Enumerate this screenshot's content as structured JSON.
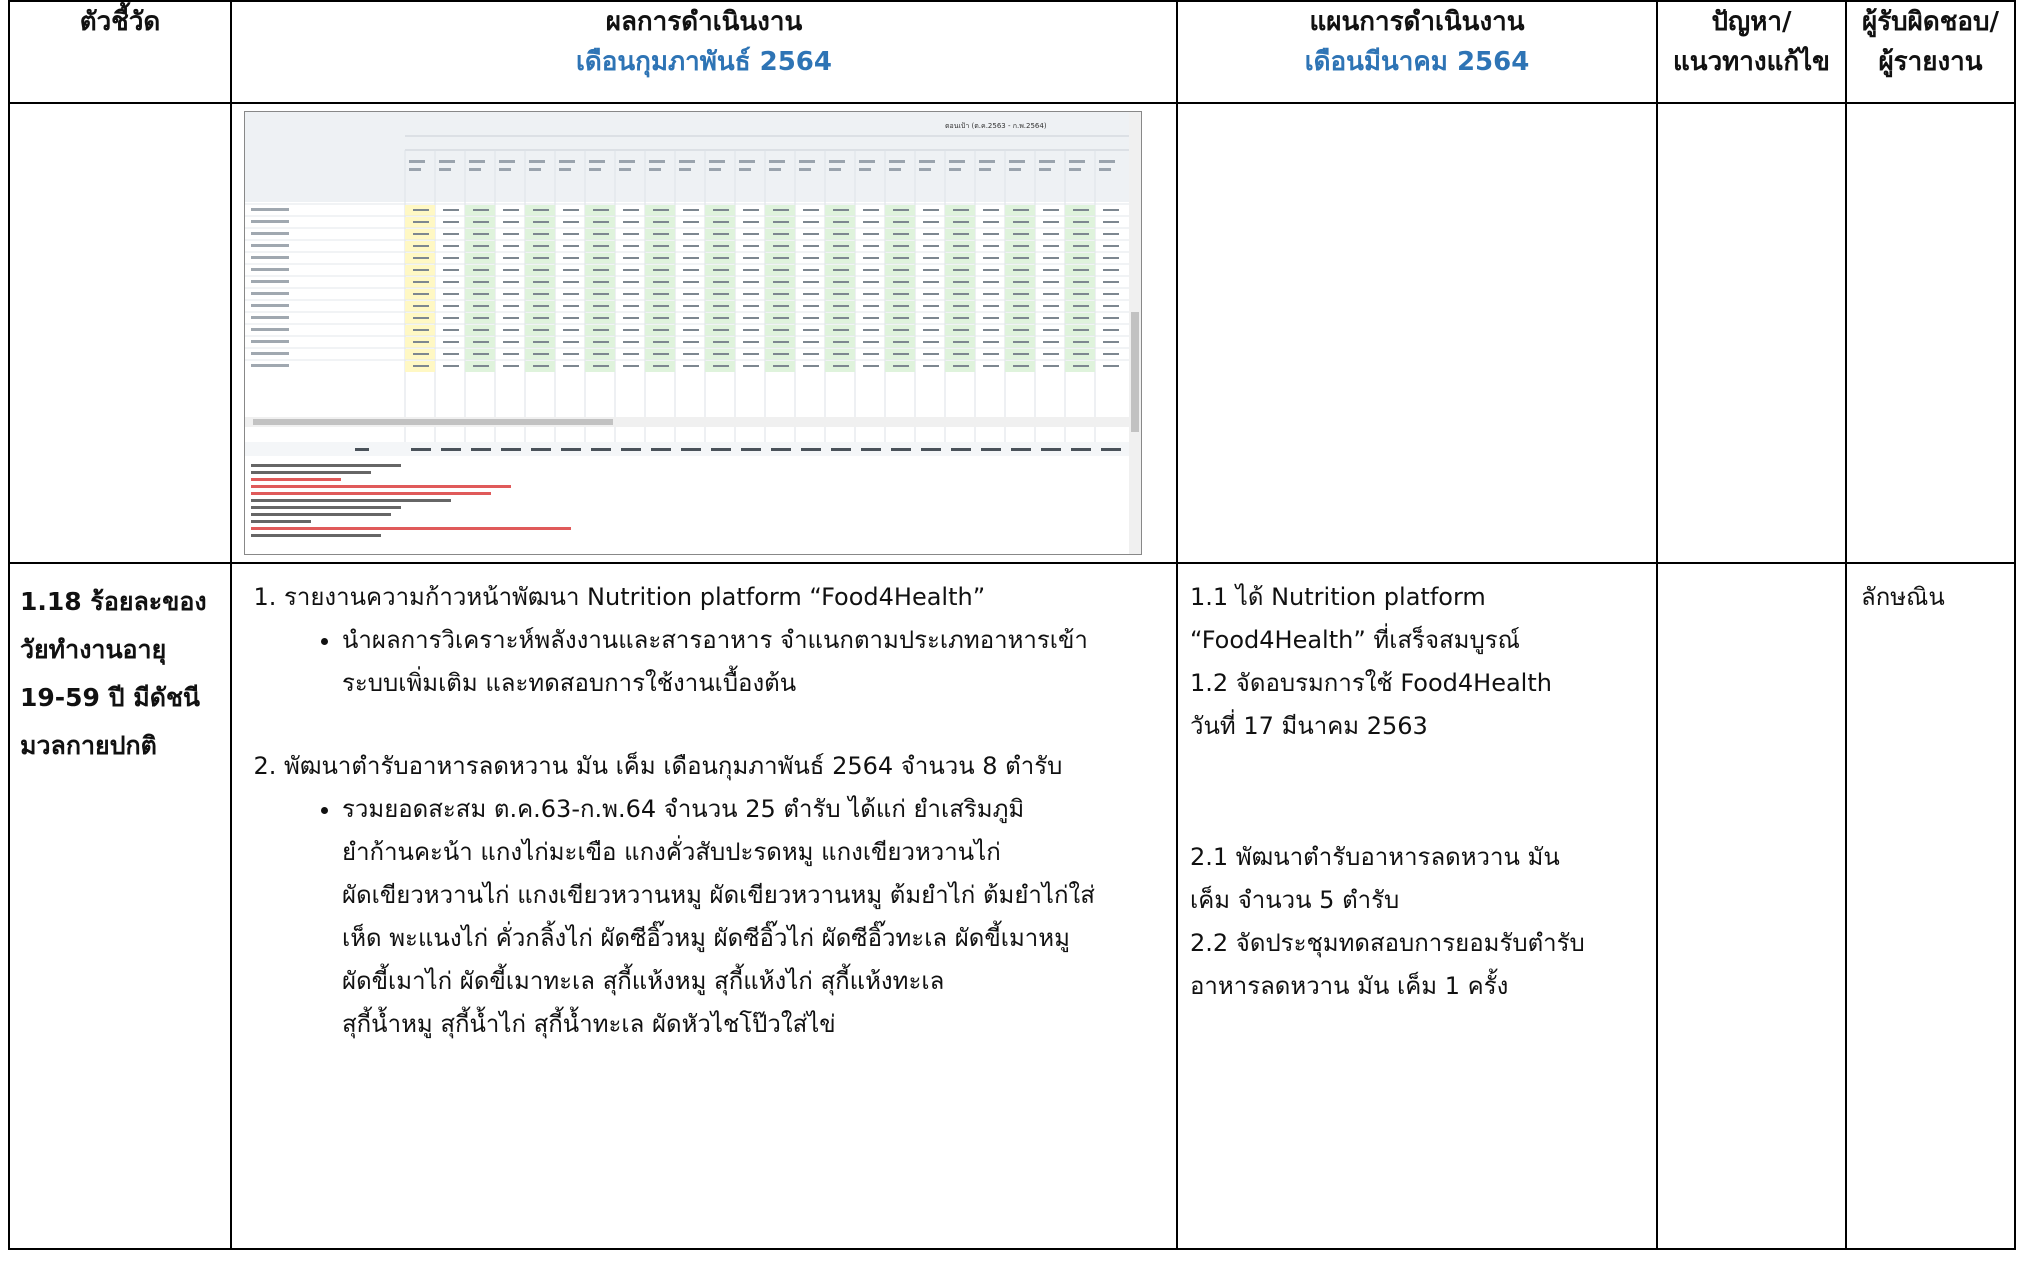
{
  "header": {
    "col_indicator": "ตัวชี้วัด",
    "col_results": "ผลการดำเนินงาน",
    "col_results_sub": "เดือนกุมภาพันธ์ 2564",
    "col_plans": "แผนการดำเนินงาน",
    "col_plans_sub": "เดือนมีนาคม 2564",
    "col_problems_1": "ปัญหา/",
    "col_problems_2": "แนวทางแก้ไข",
    "col_owner_1": "ผู้รับผิดชอบ/",
    "col_owner_2": "ผู้รายงาน"
  },
  "row2": {
    "indicator_lines": [
      "1.18 ร้อยละของ",
      "วัยทำงานอายุ",
      "19-59 ปี มีดัชนี",
      "มวลกายปกติ"
    ],
    "result_items": [
      {
        "title": "รายงานความก้าวหน้าพัฒนา Nutrition platform “Food4Health”",
        "bullets": [
          [
            "นำผลการวิเคราะห์พลังงานและสารอาหาร จำแนกตามประเภทอาหารเข้า",
            "ระบบเพิ่มเติม และทดสอบการใช้งานเบื้องต้น"
          ]
        ]
      },
      {
        "title": "พัฒนาตำรับอาหารลดหวาน มัน เค็ม เดือนกุมภาพันธ์ 2564 จำนวน 8 ตำรับ",
        "bullets": [
          [
            "รวมยอดสะสม ต.ค.63-ก.พ.64 จำนวน 25 ตำรับ ได้แก่ ยำเสริมภูมิ",
            "ยำก้านคะน้า แกงไก่มะเขือ แกงคั่วสับปะรดหมู แกงเขียวหวานไก่",
            "ผัดเขียวหวานไก่ แกงเขียวหวานหมู ผัดเขียวหวานหมู ต้มยำไก่ ต้มยำไก่ใส่",
            "เห็ด พะแนงไก่ คั่วกลิ้งไก่ ผัดซีอิ๊วหมู ผัดซีอิ๊วไก่ ผัดซีอิ๊วทะเล ผัดขี้เมาหมู",
            "ผัดขี้เมาไก่ ผัดขี้เมาทะเล สุกี้แห้งหมู สุกี้แห้งไก่ สุกี้แห้งทะเล",
            "สุกี้น้ำหมู สุกี้น้ำไก่ สุกี้น้ำทะเล ผัดหัวไชโป๊วใส่ไข่"
          ]
        ]
      }
    ],
    "plan_lines_a": [
      "1.1 ได้ Nutrition platform",
      "“Food4Health” ที่เสร็จสมบูรณ์",
      "1.2 จัดอบรมการใช้ Food4Health",
      "วันที่ 17 มีนาคม 2563"
    ],
    "plan_lines_b": [
      "2.1 พัฒนาตำรับอาหารลดหวาน มัน",
      "เค็ม จำนวน 5 ตำรับ",
      "2.2 จัดประชุมทดสอบการยอมรับตำรับ",
      "อาหารลดหวาน มัน เค็ม 1 ครั้ง"
    ],
    "owner": "ลักษณิน"
  },
  "sheet": {
    "title": "ตอนเป้า (ต.ค.2563 - ก.พ.2564)"
  }
}
